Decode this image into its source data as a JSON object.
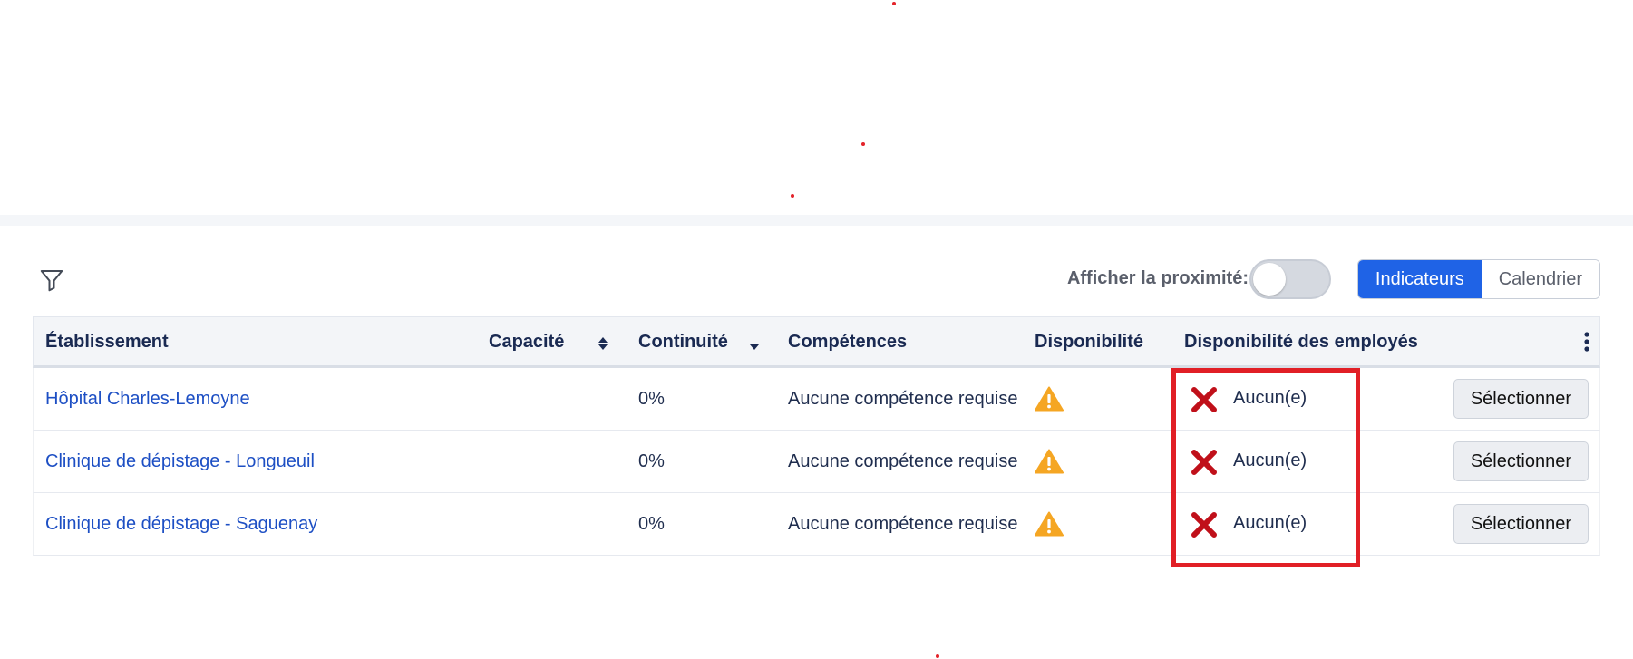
{
  "toolbar": {
    "filter_icon": "filter-icon",
    "proximity_label": "Afficher la proximité:",
    "proximity_enabled": false,
    "view_options": [
      {
        "label": "Indicateurs",
        "active": true
      },
      {
        "label": "Calendrier",
        "active": false
      }
    ]
  },
  "table": {
    "columns": {
      "establishment": "Établissement",
      "capacity": "Capacité",
      "continuity": "Continuité",
      "skills": "Compétences",
      "availability": "Disponibilité",
      "employee_availability": "Disponibilité des employés"
    },
    "rows": [
      {
        "establishment": "Hôpital Charles-Lemoyne",
        "capacity": "",
        "continuity": "0%",
        "skills": "Aucune compétence requise",
        "availability_icon": "warning-icon",
        "employee_availability": "Aucun(e)",
        "action": "Sélectionner"
      },
      {
        "establishment": "Clinique de dépistage - Longueuil",
        "capacity": "",
        "continuity": "0%",
        "skills": "Aucune compétence requise",
        "availability_icon": "warning-icon",
        "employee_availability": "Aucun(e)",
        "action": "Sélectionner"
      },
      {
        "establishment": "Clinique de dépistage - Saguenay",
        "capacity": "",
        "continuity": "0%",
        "skills": "Aucune compétence requise",
        "availability_icon": "warning-icon",
        "employee_availability": "Aucun(e)",
        "action": "Sélectionner"
      }
    ]
  },
  "colors": {
    "primary": "#1f63e6",
    "link": "#1d4fc4",
    "warning": "#f5a623",
    "error": "#c0101a",
    "highlight": "#e11f26"
  }
}
